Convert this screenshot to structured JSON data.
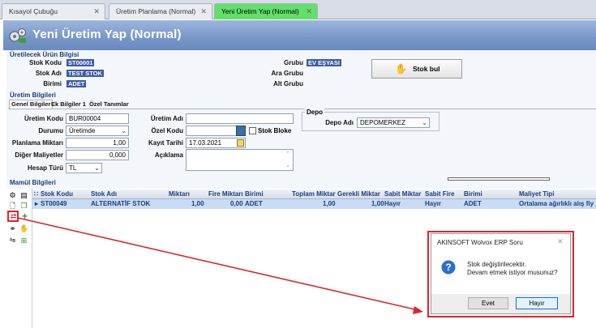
{
  "tabs": [
    {
      "label": "Kısayol Çubuğu",
      "active": false
    },
    {
      "label": "Üretim Planlama (Normal)",
      "active": false
    },
    {
      "label": "Yeni Üretim Yap (Normal)",
      "active": true
    }
  ],
  "window_title": "Yeni Üretim Yap (Normal)",
  "product_info": {
    "header": "Üretilecek Ürün Bilgisi",
    "stock_code_label": "Stok Kodu",
    "stock_code_value": "ST00001",
    "stock_name_label": "Stok Adı",
    "stock_name_value": "TEST STOK",
    "unit_label": "Birimi",
    "unit_value": "ADET",
    "group_label": "Grubu",
    "group_value": "EV EŞYASI",
    "sub_group_label": "Ara Grubu",
    "alt_group_label": "Alt Grubu",
    "find_button": "Stok bul"
  },
  "production_info": {
    "header": "Üretim Bilgileri",
    "subtabs": [
      "Genel Bilgiler",
      "Ek Bilgiler 1",
      "Özel Tanımlar"
    ],
    "code_label": "Üretim Kodu",
    "code_value": "BUR00004",
    "status_label": "Durumu",
    "status_value": "Üretimde",
    "plan_qty_label": "Planlama Miktarı",
    "plan_qty_value": "1,00",
    "other_cost_label": "Diğer Maliyetler",
    "other_cost_value": "0,000",
    "calc_type_label": "Hesap Türü",
    "calc_type_value": "TL",
    "name_label": "Üretim Adı",
    "name_value": "",
    "special_code_label": "Özel Kodu",
    "special_code_value": "",
    "stock_block_label": "Stok Bloke",
    "record_date_label": "Kayıt Tarihi",
    "record_date_value": "17.03.2021",
    "description_label": "Açıklama",
    "depot_header": "Depo",
    "depot_name_label": "Depo Adı",
    "depot_name_value": "DEPOMERKEZ"
  },
  "components": {
    "header": "Mamül Bilgileri",
    "columns": [
      "Stok Kodu",
      "Stok Adı",
      "Miktarı",
      "Fire Miktarı",
      "Birimi",
      "Toplam Miktar",
      "Gerekli Miktar",
      "Sabit Miktar",
      "Sabit Fire",
      "Birimi",
      "Maliyet Tipi"
    ],
    "rows": [
      [
        "ST00049",
        "ALTERNATİF STOK",
        "1,00",
        "0,00",
        "ADET",
        "1,00",
        "1,00",
        "Hayır",
        "Hayır",
        "ADET",
        "Ortalama ağırlıklı alış fiy"
      ]
    ]
  },
  "dialog": {
    "title": "AKINSOFT Wolvox ERP Soru",
    "message_line1": "Stok değiştirilecektir.",
    "message_line2": "Devam etmek istiyor musunuz?",
    "yes_button": "Evet",
    "no_button": "Hayır"
  },
  "colors": {
    "active_tab": "#62e06a",
    "title_bar": "#7796c8",
    "highlight": "#d9262c"
  }
}
